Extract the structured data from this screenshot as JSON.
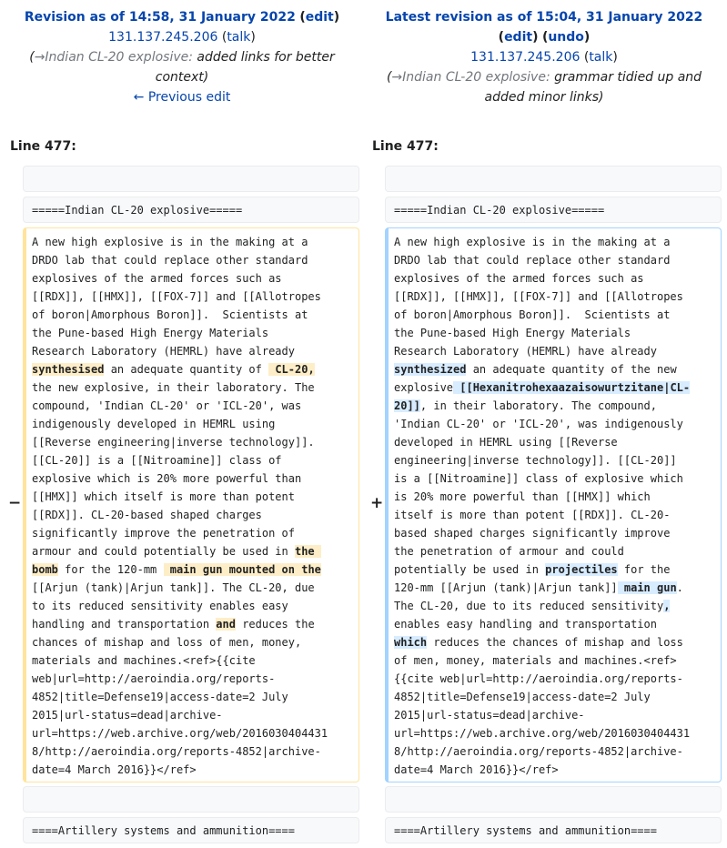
{
  "left_header": {
    "title": "Revision as of 14:58, 31 January 2022",
    "edit": "edit",
    "user": "131.137.245.206",
    "talk": "talk",
    "summary_section": "→Indian CL-20 explosive:",
    "summary_line1": "added links for better",
    "summary_line2": "context)",
    "prev_edit": "← Previous edit"
  },
  "right_header": {
    "title": "Latest revision as of 15:04, 31 January 2022",
    "edit": "edit",
    "undo": "undo",
    "user": "131.137.245.206",
    "talk": "talk",
    "summary_section": "→Indian CL-20 explosive:",
    "summary_line1": "grammar tidied up and",
    "summary_line2": "added minor links)"
  },
  "line_label": "Line 477:",
  "heading_line": "=====Indian CL-20 explosive=====",
  "footer_line": "====Artillery systems and ammunition====",
  "markers": {
    "removed": "−",
    "added": "+"
  },
  "left_lines": [
    [
      [
        "A new high explosive is in the making at a",
        0
      ]
    ],
    [
      [
        "DRDO lab that could replace other standard",
        0
      ]
    ],
    [
      [
        "explosives of the armed forces such as",
        0
      ]
    ],
    [
      [
        "[[RDX]], [[HMX]], [[FOX-7]] and [[Allotropes",
        0
      ]
    ],
    [
      [
        "of boron|Amorphous Boron]].  Scientists at",
        0
      ]
    ],
    [
      [
        "the Pune-based High Energy Materials",
        0
      ]
    ],
    [
      [
        "Research Laboratory (HEMRL) have already",
        0
      ]
    ],
    [
      [
        "synthesised",
        1
      ],
      [
        " an adequate quantity of ",
        0
      ],
      [
        " CL-20,",
        1
      ]
    ],
    [
      [
        "the new explosive, in their laboratory. The",
        0
      ]
    ],
    [
      [
        "compound, 'Indian CL-20' or 'ICL-20', was",
        0
      ]
    ],
    [
      [
        "indigenously developed in HEMRL using",
        0
      ]
    ],
    [
      [
        "[[Reverse engineering|inverse technology]].",
        0
      ]
    ],
    [
      [
        "[[CL-20]] is a [[Nitroamine]] class of",
        0
      ]
    ],
    [
      [
        "explosive which is 20% more powerful than",
        0
      ]
    ],
    [
      [
        "[[HMX]] which itself is more than potent",
        0
      ]
    ],
    [
      [
        "[[RDX]]. CL-20-based shaped charges",
        0
      ]
    ],
    [
      [
        "significantly improve the penetration of",
        0
      ]
    ],
    [
      [
        "armour and could potentially be used in ",
        0
      ],
      [
        "the ",
        1
      ]
    ],
    [
      [
        "bomb",
        1
      ],
      [
        " for the 120-mm ",
        0
      ],
      [
        " main gun mounted on the",
        1
      ]
    ],
    [
      [
        "[[Arjun (tank)|Arjun tank]]. The CL-20, due",
        0
      ]
    ],
    [
      [
        "to its reduced sensitivity enables easy",
        0
      ]
    ],
    [
      [
        "handling and transportation ",
        0
      ],
      [
        "and",
        1
      ],
      [
        " reduces the",
        0
      ]
    ],
    [
      [
        "chances of mishap and loss of men, money,",
        0
      ]
    ],
    [
      [
        "materials and machines.<ref>{{cite",
        0
      ]
    ],
    [
      [
        "web|url=http://aeroindia.org/reports-",
        0
      ]
    ],
    [
      [
        "4852|title=Defense19|access-date=2 July",
        0
      ]
    ],
    [
      [
        "2015|url-status=dead|archive-",
        0
      ]
    ],
    [
      [
        "url=https://web.archive.org/web/2016030404431",
        0
      ]
    ],
    [
      [
        "8/http://aeroindia.org/reports-4852|archive-",
        0
      ]
    ],
    [
      [
        "date=4 March 2016}}</ref>",
        0
      ]
    ]
  ],
  "right_lines": [
    [
      [
        "A new high explosive is in the making at a",
        0
      ]
    ],
    [
      [
        "DRDO lab that could replace other standard",
        0
      ]
    ],
    [
      [
        "explosives of the armed forces such as",
        0
      ]
    ],
    [
      [
        "[[RDX]], [[HMX]], [[FOX-7]] and [[Allotropes",
        0
      ]
    ],
    [
      [
        "of boron|Amorphous Boron]].  Scientists at",
        0
      ]
    ],
    [
      [
        "the Pune-based High Energy Materials",
        0
      ]
    ],
    [
      [
        "Research Laboratory (HEMRL) have already",
        0
      ]
    ],
    [
      [
        "synthesized",
        1
      ],
      [
        " an adequate quantity of the new",
        0
      ]
    ],
    [
      [
        "explosive",
        0
      ],
      [
        " [[Hexanitrohexaazaisowurtzitane|CL-",
        1
      ]
    ],
    [
      [
        "20]]",
        1
      ],
      [
        ", in their laboratory. The compound,",
        0
      ]
    ],
    [
      [
        "'Indian CL-20' or 'ICL-20', was indigenously",
        0
      ]
    ],
    [
      [
        "developed in HEMRL using [[Reverse",
        0
      ]
    ],
    [
      [
        "engineering|inverse technology]]. [[CL-20]]",
        0
      ]
    ],
    [
      [
        "is a [[Nitroamine]] class of explosive which",
        0
      ]
    ],
    [
      [
        "is 20% more powerful than [[HMX]] which",
        0
      ]
    ],
    [
      [
        "itself is more than potent [[RDX]]. CL-20-",
        0
      ]
    ],
    [
      [
        "based shaped charges significantly improve",
        0
      ]
    ],
    [
      [
        "the penetration of armour and could",
        0
      ]
    ],
    [
      [
        "potentially be used in ",
        0
      ],
      [
        "projectiles",
        1
      ],
      [
        " for the",
        0
      ]
    ],
    [
      [
        "120-mm [[Arjun (tank)|Arjun tank]]",
        0
      ],
      [
        " main gun",
        1
      ],
      [
        ".",
        0
      ]
    ],
    [
      [
        "The CL-20, due to its reduced sensitivity",
        0
      ],
      [
        ",",
        1
      ]
    ],
    [
      [
        "enables easy handling and transportation",
        0
      ]
    ],
    [
      [
        "which",
        1
      ],
      [
        " reduces the chances of mishap and loss",
        0
      ]
    ],
    [
      [
        "of men, money, materials and machines.<ref>",
        0
      ]
    ],
    [
      [
        "{{cite web|url=http://aeroindia.org/reports-",
        0
      ]
    ],
    [
      [
        "4852|title=Defense19|access-date=2 July",
        0
      ]
    ],
    [
      [
        "2015|url-status=dead|archive-",
        0
      ]
    ],
    [
      [
        "url=https://web.archive.org/web/2016030404431",
        0
      ]
    ],
    [
      [
        "8/http://aeroindia.org/reports-4852|archive-",
        0
      ]
    ],
    [
      [
        "date=4 March 2016}}</ref>",
        0
      ]
    ]
  ]
}
